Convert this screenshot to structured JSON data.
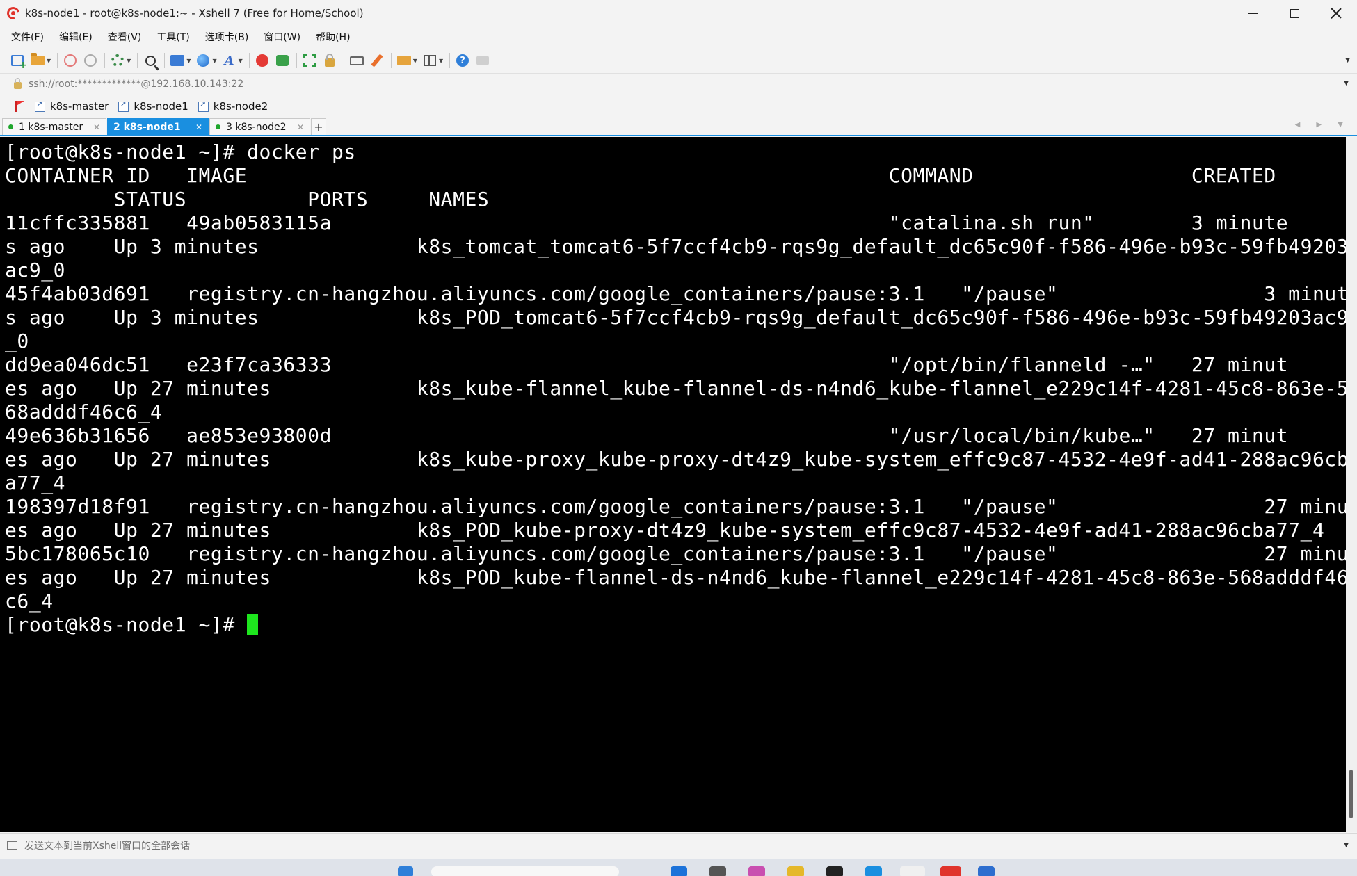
{
  "window": {
    "title": "k8s-node1 - root@k8s-node1:~ - Xshell 7 (Free for Home/School)"
  },
  "menu": [
    "文件(F)",
    "编辑(E)",
    "查看(V)",
    "工具(T)",
    "选项卡(B)",
    "窗口(W)",
    "帮助(H)"
  ],
  "address": {
    "text": "ssh://root:*************@192.168.10.143:22"
  },
  "links": [
    "k8s-master",
    "k8s-node1",
    "k8s-node2"
  ],
  "tabs": [
    {
      "number": "1",
      "label": "k8s-master",
      "active": false
    },
    {
      "number": "2",
      "label": "k8s-node1",
      "active": true
    },
    {
      "number": "3",
      "label": "k8s-node2",
      "active": false
    }
  ],
  "terminal": {
    "lines": [
      "[root@k8s-node1 ~]# docker ps",
      "CONTAINER ID   IMAGE                                                     COMMAND                  CREATED",
      "         STATUS          PORTS     NAMES",
      "11cffc335881   49ab0583115a                                              \"catalina.sh run\"        3 minute",
      "s ago    Up 3 minutes             k8s_tomcat_tomcat6-5f7ccf4cb9-rqs9g_default_dc65c90f-f586-496e-b93c-59fb49203",
      "ac9_0",
      "45f4ab03d691   registry.cn-hangzhou.aliyuncs.com/google_containers/pause:3.1   \"/pause\"                 3 minute",
      "s ago    Up 3 minutes             k8s_POD_tomcat6-5f7ccf4cb9-rqs9g_default_dc65c90f-f586-496e-b93c-59fb49203ac9",
      "_0",
      "dd9ea046dc51   e23f7ca36333                                              \"/opt/bin/flanneld -…\"   27 minut",
      "es ago   Up 27 minutes            k8s_kube-flannel_kube-flannel-ds-n4nd6_kube-flannel_e229c14f-4281-45c8-863e-5",
      "68adddf46c6_4",
      "49e636b31656   ae853e93800d                                              \"/usr/local/bin/kube…\"   27 minut",
      "es ago   Up 27 minutes            k8s_kube-proxy_kube-proxy-dt4z9_kube-system_effc9c87-4532-4e9f-ad41-288ac96cb",
      "a77_4",
      "198397d18f91   registry.cn-hangzhou.aliyuncs.com/google_containers/pause:3.1   \"/pause\"                 27 minut",
      "es ago   Up 27 minutes            k8s_POD_kube-proxy-dt4z9_kube-system_effc9c87-4532-4e9f-ad41-288ac96cba77_4",
      "5bc178065c10   registry.cn-hangzhou.aliyuncs.com/google_containers/pause:3.1   \"/pause\"                 27 minut",
      "es ago   Up 27 minutes            k8s_POD_kube-flannel-ds-n4nd6_kube-flannel_e229c14f-4281-45c8-863e-568adddf46",
      "c6_4"
    ],
    "prompt": "[root@k8s-node1 ~]# "
  },
  "compose": {
    "placeholder": "发送文本到当前Xshell窗口的全部会话"
  },
  "colors": {
    "accent": "#1a8fe0",
    "terminal_bg": "#000000",
    "terminal_fg": "#ffffff",
    "cursor": "#1ee61e"
  }
}
